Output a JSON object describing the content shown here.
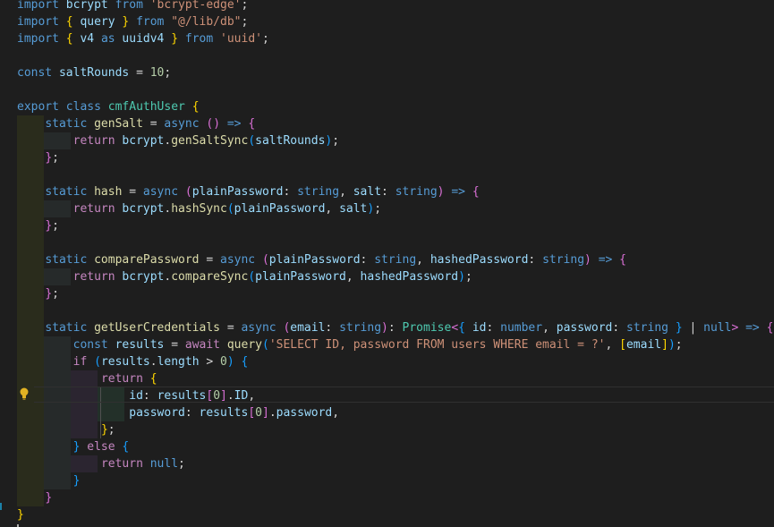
{
  "editor": {
    "language": "TypeScript",
    "code_lines": [
      "import bcrypt from 'bcrypt-edge';",
      "import { query } from \"@/lib/db\";",
      "import { v4 as uuidv4 } from 'uuid';",
      "",
      "const saltRounds = 10;",
      "",
      "export class cmfAuthUser {",
      "    static genSalt = async () => {",
      "        return bcrypt.genSaltSync(saltRounds);",
      "    };",
      "",
      "    static hash = async (plainPassword: string, salt: string) => {",
      "        return bcrypt.hashSync(plainPassword, salt);",
      "    };",
      "",
      "    static comparePassword = async (plainPassword: string, hashedPassword: string) => {",
      "        return bcrypt.compareSync(plainPassword, hashedPassword);",
      "    };",
      "",
      "    static getUserCredentials = async (email: string): Promise<{ id: number, password: string } | null> => {",
      "        const results = await query('SELECT ID, password FROM users WHERE email = ?', [email]);",
      "        if (results.length > 0) {",
      "            return {",
      "                id: results[0].ID,",
      "                password: results[0].password,",
      "            };",
      "        } else {",
      "            return null;",
      "        }",
      "    }",
      "}"
    ],
    "current_line": 23,
    "lightbulb_icon": "lightbulb-icon",
    "colors": {
      "background": "#1e1e1e",
      "keyword": "#569cd6",
      "control": "#c586c0",
      "string": "#ce9178",
      "number": "#b5cea8",
      "variable": "#9cdcfe",
      "function": "#dcdcaa",
      "type": "#4ec9b0",
      "bracket_level_1": "#ffd700",
      "bracket_level_2": "#da70d6",
      "bracket_level_3": "#179fff"
    }
  }
}
